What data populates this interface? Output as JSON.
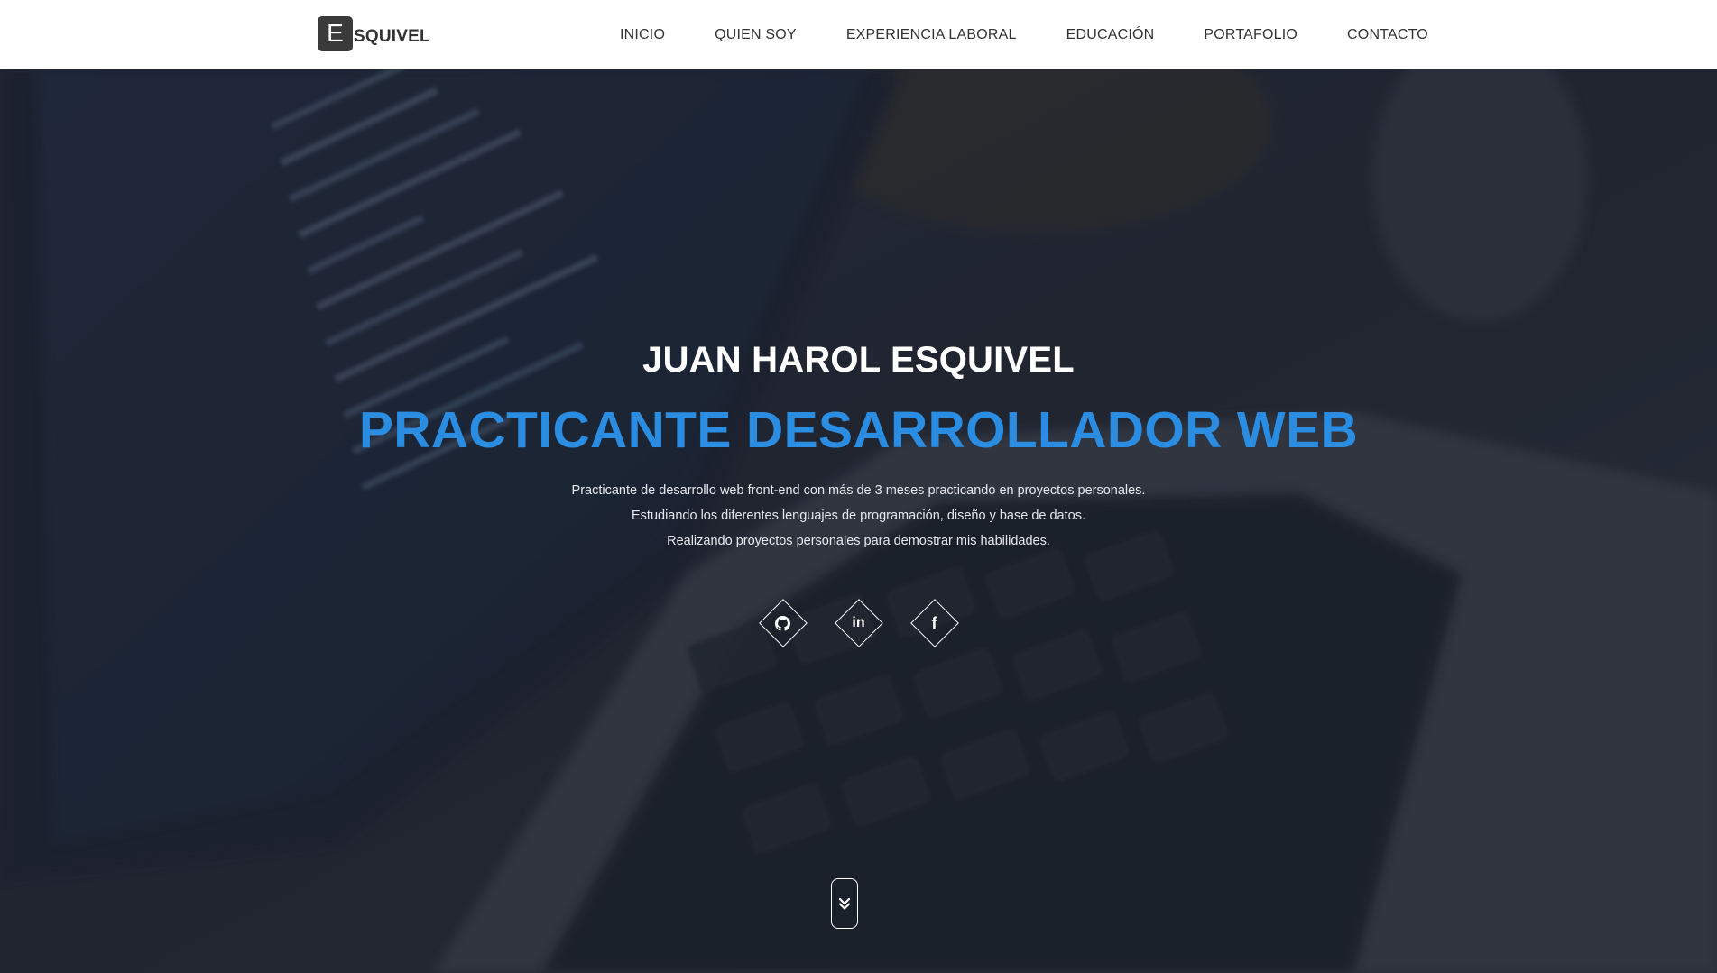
{
  "brand": {
    "initial": "E",
    "rest": "SQUIVEL"
  },
  "nav": {
    "items": [
      {
        "label": "INICIO"
      },
      {
        "label": "QUIEN SOY"
      },
      {
        "label": "EXPERIENCIA LABORAL"
      },
      {
        "label": "EDUCACIÓN"
      },
      {
        "label": "PORTAFOLIO"
      },
      {
        "label": "CONTACTO"
      }
    ]
  },
  "hero": {
    "name": "JUAN HAROL ESQUIVEL",
    "role": "PRACTICANTE DESARROLLADOR WEB",
    "description": [
      "Practicante de desarrollo web front-end con más de 3 meses practicando en proyectos personales.",
      "Estudiando los diferentes lenguajes de programación, diseño y base de datos.",
      "Realizando proyectos personales para demostrar mis habilidades."
    ],
    "socials": [
      {
        "icon": "github-icon",
        "glyph": ""
      },
      {
        "icon": "linkedin-icon",
        "glyph": "in"
      },
      {
        "icon": "facebook-icon",
        "glyph": "f"
      }
    ],
    "scroll_icon": "double-chevron-down-icon"
  },
  "colors": {
    "accent": "#2b8de2",
    "navbar_bg": "#ffffff",
    "nav_text": "#333333",
    "hero_overlay": "#1c202c"
  }
}
